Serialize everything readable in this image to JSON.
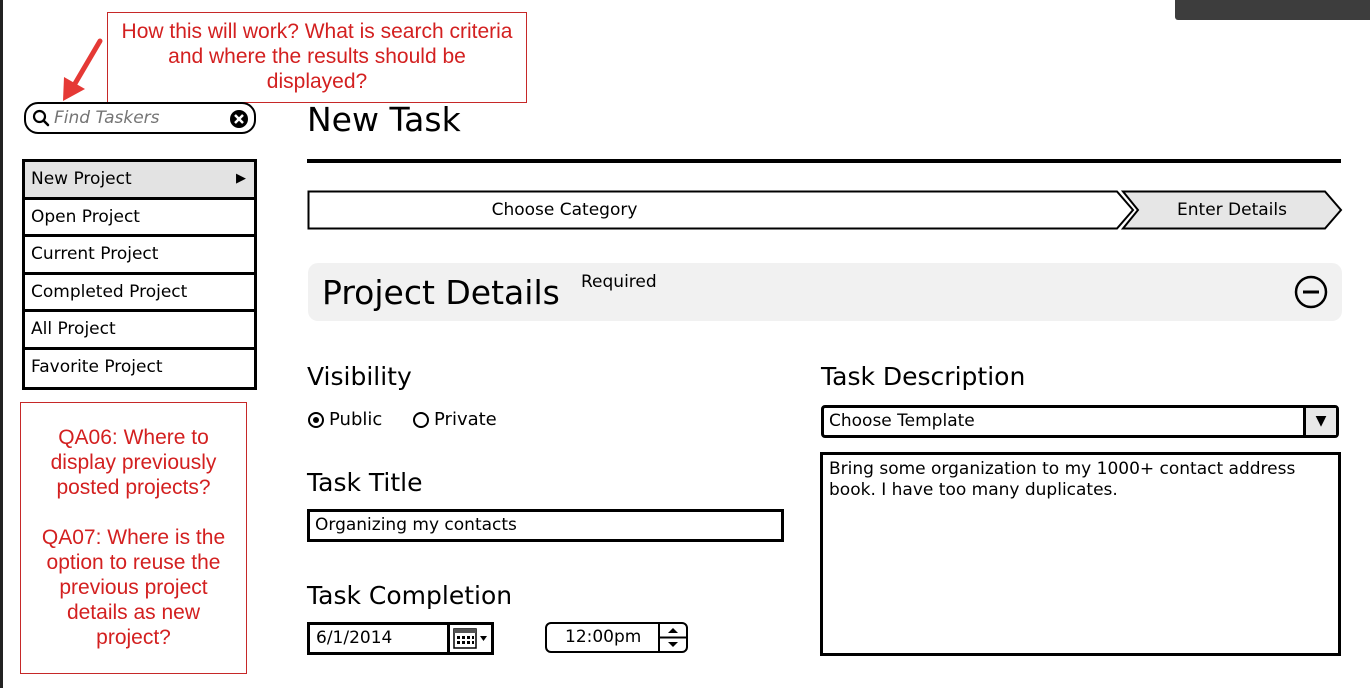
{
  "annotations": {
    "search_note": "How this will work? What is search criteria and where the results should be displayed?",
    "project_note_1": "QA06: Where to display previously posted projects?",
    "project_note_2": "QA07: Where is the option to reuse the  previous project details as new project?"
  },
  "search": {
    "placeholder": "Find Taskers"
  },
  "menu": {
    "items": [
      {
        "label": "New Project"
      },
      {
        "label": "Open Project"
      },
      {
        "label": "Current Project"
      },
      {
        "label": "Completed Project"
      },
      {
        "label": "All Project"
      },
      {
        "label": "Favorite Project"
      }
    ]
  },
  "page": {
    "title": "New Task"
  },
  "wizard": {
    "steps": [
      "Choose Category",
      "Enter Details"
    ],
    "active_step": 1
  },
  "panel": {
    "title": "Project Details",
    "required_label": "Required"
  },
  "visibility": {
    "label": "Visibility",
    "options": [
      "Public",
      "Private"
    ],
    "selected": "Public"
  },
  "task_title": {
    "label": "Task Title",
    "value": "Organizing my contacts"
  },
  "completion": {
    "label": "Task Completion",
    "date": "6/1/2014",
    "time": "12:00pm"
  },
  "description": {
    "label": "Task Description",
    "template_value": "Choose Template",
    "text": "Bring some organization to my 1000+ contact address book. I have too many duplicates."
  },
  "colors": {
    "annotation_red": "#d32020",
    "active_menu_bg": "#e3e3e3",
    "panel_bg": "#f1f1f1"
  }
}
